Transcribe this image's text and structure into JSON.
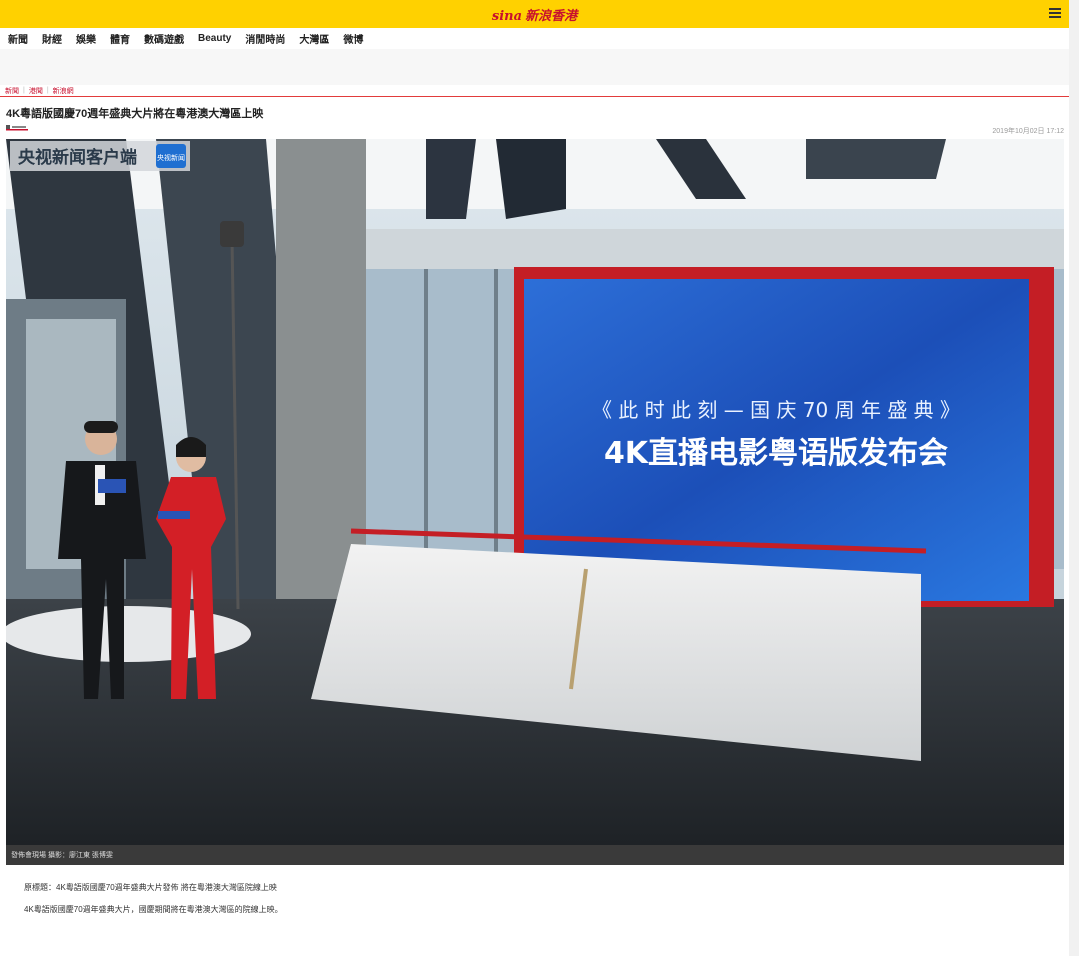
{
  "header": {
    "logo_sina": "sina",
    "logo_site": "新浪香港",
    "menu_icon": "hamburger-menu-icon"
  },
  "nav": {
    "items": [
      "新聞",
      "財經",
      "娛樂",
      "體育",
      "數碼遊戲",
      "Beauty",
      "消閒時尚",
      "大灣區",
      "微博"
    ]
  },
  "breadcrumb": {
    "items": [
      "新聞",
      "港聞",
      "新浪網"
    ]
  },
  "article": {
    "title": "4K粵語版國慶70週年盛典大片將在粵港澳大灣區上映",
    "date": "2019年10月02日  17:12",
    "photo": {
      "watermark": "央视新闻客户端",
      "watermark_badge": "央视新闻",
      "screen_line1": "《 此 时 此 刻 — 国 庆 70 周 年 盛 典 》",
      "screen_line2": "4K直播电影粤语版发布会",
      "caption": "發佈會現場 攝影：廖江東 張博雯"
    },
    "paragraphs": [
      "原標題：4K粵語版國慶70週年盛典大片發佈 將在粵港澳大灣區院線上映",
      "4K粵語版國慶70週年盛典大片，國慶期間將在粵港澳大灣區的院線上映。"
    ]
  },
  "colors": {
    "topbar": "#ffd100",
    "brand_red": "#c8102e",
    "caption_bg": "#3a3a3a"
  }
}
